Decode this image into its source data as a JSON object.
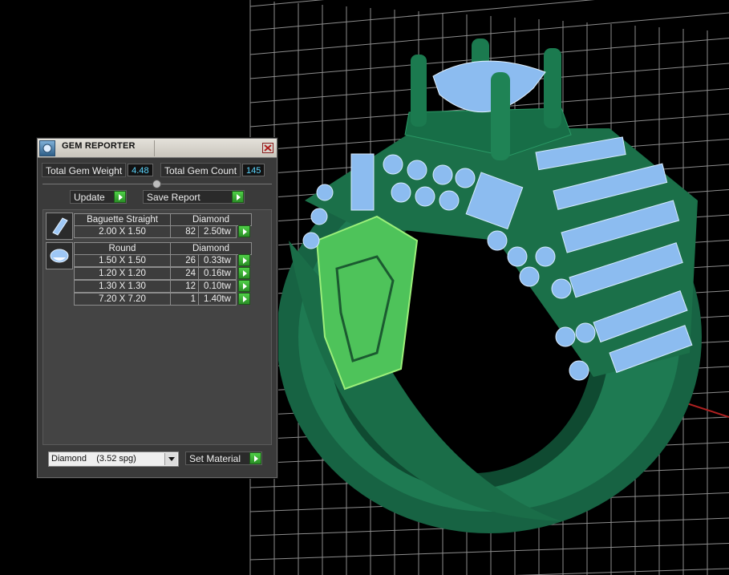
{
  "window_title": "GEM REPORTER",
  "icons": {
    "title": "gem-reporter-icon",
    "close": "close-icon",
    "baguette": "baguette-gem-icon",
    "round": "round-gem-icon"
  },
  "colors": {
    "ring_green": "#1f6f4a",
    "gem_blue": "#8cbcf0",
    "value_text": "#5ad6ff",
    "go_button": "#3fbf3a"
  },
  "stats": {
    "weight_label": "Total Gem Weight",
    "weight_value": "4.48",
    "count_label": "Total Gem Count",
    "count_value": "145"
  },
  "toolbar": {
    "update_label": "Update",
    "save_report_label": "Save Report"
  },
  "groups": [
    {
      "shape": "Baguette Straight",
      "material": "Diamond",
      "rows": [
        {
          "size": "2.00 X 1.50",
          "count": "82",
          "weight": "2.50tw"
        }
      ]
    },
    {
      "shape": "Round",
      "material": "Diamond",
      "rows": [
        {
          "size": "1.50 X 1.50",
          "count": "26",
          "weight": "0.33tw"
        },
        {
          "size": "1.20 X 1.20",
          "count": "24",
          "weight": "0.16tw"
        },
        {
          "size": "1.30 X 1.30",
          "count": "12",
          "weight": "0.10tw"
        },
        {
          "size": "7.20 X 7.20",
          "count": "1",
          "weight": "1.40tw"
        }
      ]
    }
  ],
  "footer": {
    "material_select_value": "Diamond    (3.52 spg)",
    "set_material_label": "Set Material"
  }
}
